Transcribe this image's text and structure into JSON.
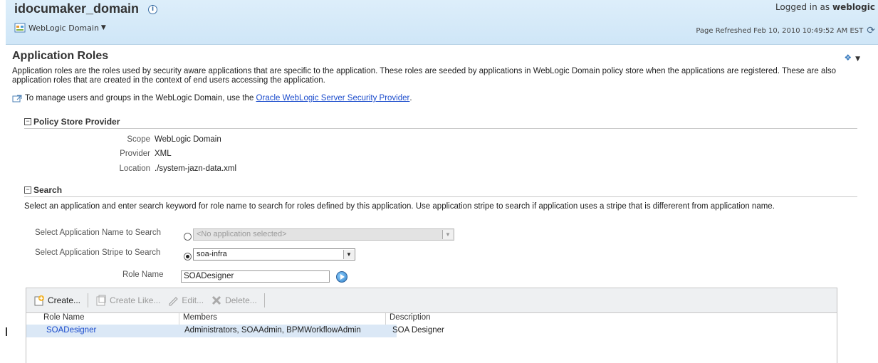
{
  "header": {
    "domain_name": "idocumaker_domain",
    "menu_label": "WebLogic Domain",
    "logged_in_prefix": "Logged in as",
    "logged_in_user": "weblogic",
    "page_refreshed": "Page Refreshed Feb 10, 2010 10:49:52 AM EST"
  },
  "page": {
    "title": "Application Roles",
    "description": "Application roles are the roles used by security aware applications that are specific to the application. These roles are seeded by applications in WebLogic Domain policy store when the applications are registered. These are also application roles that are created in the context of end users accessing the application.",
    "manage_text": "To manage users and groups in the WebLogic Domain, use the",
    "manage_link": "Oracle WebLogic Server Security Provider",
    "manage_suffix": "."
  },
  "policy_store": {
    "header": "Policy Store Provider",
    "scope_label": "Scope",
    "scope_value": "WebLogic Domain",
    "provider_label": "Provider",
    "provider_value": "XML",
    "location_label": "Location",
    "location_value": "./system-jazn-data.xml"
  },
  "search": {
    "header": "Search",
    "description": "Select an application and enter search keyword for role name to search for roles defined by this application. Use application stripe to search if application uses a stripe that is differerent from application name.",
    "app_name_label": "Select Application Name to Search",
    "app_name_value": "<No application selected>",
    "app_stripe_label": "Select Application Stripe to Search",
    "app_stripe_value": "soa-infra",
    "role_name_label": "Role Name",
    "role_name_value": "SOADesigner"
  },
  "toolbar": {
    "create": "Create...",
    "create_like": "Create Like...",
    "edit": "Edit...",
    "delete": "Delete..."
  },
  "table": {
    "columns": [
      "Role Name",
      "Members",
      "Description"
    ],
    "rows": [
      {
        "role_name": "SOADesigner",
        "members": "Administrators, SOAAdmin, BPMWorkflowAdmin",
        "description": "SOA Designer"
      }
    ]
  },
  "icons": {
    "info": "info-icon",
    "domain": "weblogic-domain-icon",
    "refresh": "refresh-icon",
    "external": "external-link-icon",
    "go": "go-search-icon"
  }
}
